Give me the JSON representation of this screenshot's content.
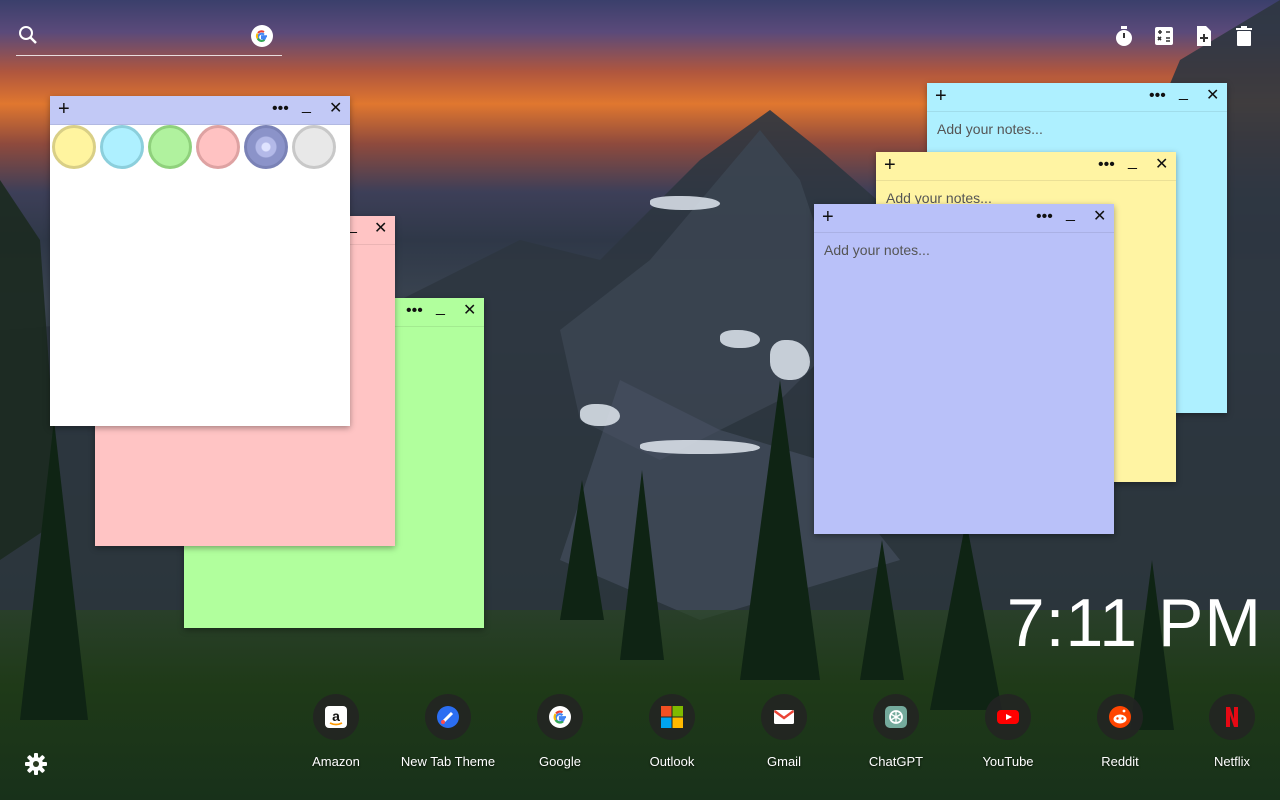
{
  "search": {
    "placeholder": ""
  },
  "tools": [
    "timer-icon",
    "calculator-icon",
    "new-note-icon",
    "trash-icon"
  ],
  "notes": {
    "placeholder": "Add your notes...",
    "add_label": "+",
    "more_label": "•••",
    "minimize_label": "_",
    "close_label": "✕",
    "colors": {
      "white": "#ffffff",
      "pink": "#ffc4c4",
      "green": "#b1ff9d",
      "cyan": "#aef0ff",
      "yellow": "#fff4a3",
      "periwinkle": "#b9c1f9"
    }
  },
  "palette": [
    "#fff49f",
    "#aef0ff",
    "#b0f29e",
    "#ffc2c2",
    "#8b93c9",
    "#e8e8e8"
  ],
  "clock": {
    "time": "7:11 PM"
  },
  "dock": [
    {
      "label": "Amazon",
      "icon": "amazon-icon"
    },
    {
      "label": "New Tab Theme",
      "icon": "new-tab-theme-icon"
    },
    {
      "label": "Google",
      "icon": "google-icon"
    },
    {
      "label": "Outlook",
      "icon": "outlook-icon"
    },
    {
      "label": "Gmail",
      "icon": "gmail-icon"
    },
    {
      "label": "ChatGPT",
      "icon": "chatgpt-icon"
    },
    {
      "label": "YouTube",
      "icon": "youtube-icon"
    },
    {
      "label": "Reddit",
      "icon": "reddit-icon"
    },
    {
      "label": "Netflix",
      "icon": "netflix-icon"
    }
  ]
}
